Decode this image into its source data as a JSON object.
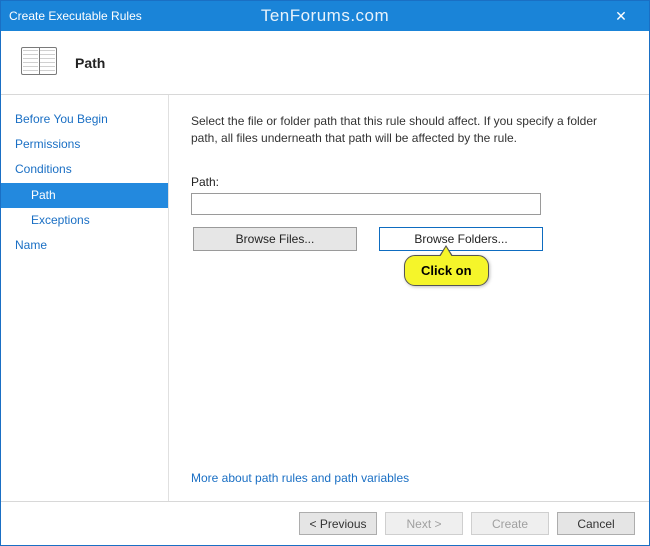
{
  "window": {
    "title": "Create Executable Rules",
    "watermark": "TenForums.com",
    "close_glyph": "✕"
  },
  "header": {
    "title": "Path"
  },
  "sidebar": {
    "items": [
      {
        "label": "Before You Begin",
        "sub": false,
        "active": false
      },
      {
        "label": "Permissions",
        "sub": false,
        "active": false
      },
      {
        "label": "Conditions",
        "sub": false,
        "active": false
      },
      {
        "label": "Path",
        "sub": true,
        "active": true
      },
      {
        "label": "Exceptions",
        "sub": true,
        "active": false
      },
      {
        "label": "Name",
        "sub": false,
        "active": false
      }
    ]
  },
  "content": {
    "description": "Select the file or folder path that this rule should affect. If you specify a folder path, all files underneath that path will be affected by the rule.",
    "path_label": "Path:",
    "path_value": "",
    "browse_files_label": "Browse Files...",
    "browse_folders_label": "Browse Folders...",
    "more_link": "More about path rules and path variables"
  },
  "callout": {
    "text": "Click on"
  },
  "footer": {
    "previous": "< Previous",
    "next": "Next >",
    "create": "Create",
    "cancel": "Cancel"
  }
}
